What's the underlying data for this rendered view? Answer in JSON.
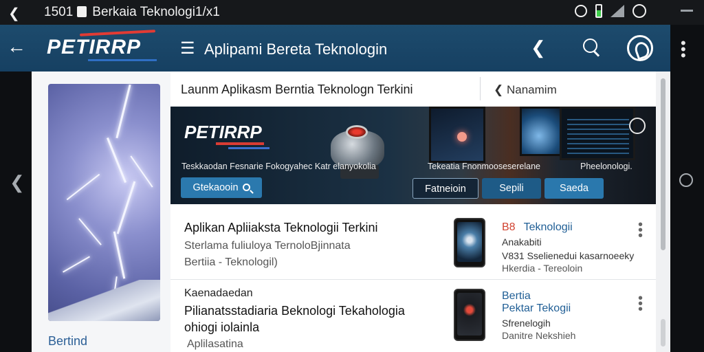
{
  "statusbar": {
    "time": "1501",
    "title": "Berkaia Teknologi1/x1",
    "icons": [
      "back-icon",
      "sim-icon",
      "clock-icon",
      "battery-icon",
      "signal-icon",
      "alarm-icon"
    ]
  },
  "appbar": {
    "logo": "PETIRRP",
    "title": "Aplipami Bereta Teknologin",
    "icons": [
      "back-arrow-icon",
      "menu-icon",
      "share-icon",
      "search-icon",
      "profile-icon",
      "more-vert-icon"
    ]
  },
  "sidepanel": {
    "label": "Bertind"
  },
  "main": {
    "heading": "Launm Aplikasm Berntia Teknologn Terkini",
    "nav_link": "Nanamim",
    "banner": {
      "logo": "PETIRRP",
      "tagline1": "Teskkaodan Fesnarie Fokogyahec Katr elanyokolia",
      "tagline2": "Tekeatia Fnonmooseserelane",
      "tagline3": "Pheelonologi.",
      "primary_button": "Gtekaooin",
      "button_outline": "Fatneioin",
      "button_b": "Sepili",
      "button_c": "Saeda"
    },
    "articles": [
      {
        "title": "Aplikan Apliiaksta Teknologii Terkini",
        "subtitle": "Sterlama fuliuloya TernoloBjinnata",
        "category": "Bertiia - Teknologil)",
        "meta_badge": "B8",
        "meta_title": "Teknologii",
        "meta_line1": "Anakabiti",
        "meta_line2": "V831 Sselienedui kasarnoeeky",
        "meta_line3": "Hkerdia - Tereoloin"
      },
      {
        "label": "Kaenadaedan",
        "title": "Pilianatsstadiaria Beknologi Tekahologia",
        "title2": "ohiogi iolainla",
        "subtitle": "Aplilasatina",
        "meta_title": "Bertia",
        "meta_line1": "Pektar Tekogii",
        "meta_line2": "Sfrenelogih",
        "meta_line3": "Danitre Nekshieh"
      }
    ]
  },
  "colors": {
    "appbar": "#1b4868",
    "accent": "#2b79ae",
    "logo_red": "#e23b34",
    "link": "#1f5e95"
  }
}
